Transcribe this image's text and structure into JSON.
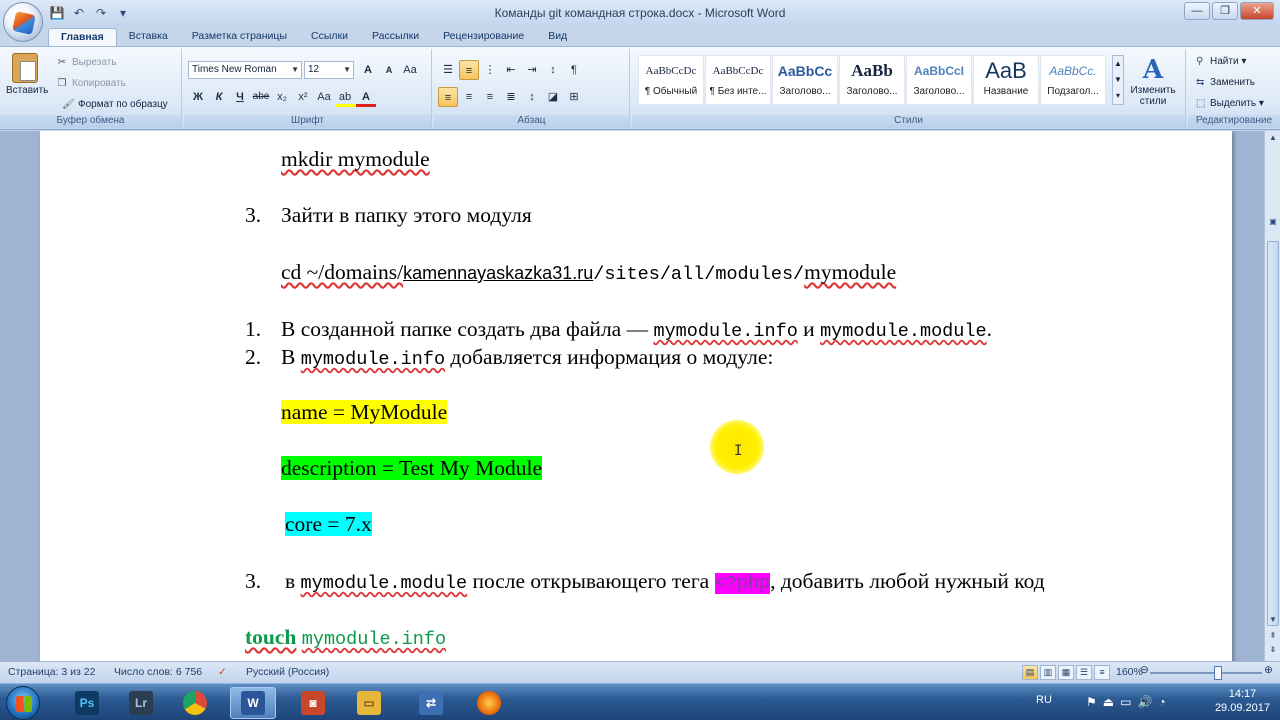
{
  "window": {
    "title": "Команды git командная строка.docx - Microsoft Word",
    "controls": [
      "—",
      "❐",
      "✕"
    ]
  },
  "qat": {
    "save": "💾",
    "undo": "↶",
    "redo": "↷",
    "more": "▾"
  },
  "tabs": [
    "Главная",
    "Вставка",
    "Разметка страницы",
    "Ссылки",
    "Рассылки",
    "Рецензирование",
    "Вид"
  ],
  "ribbon": {
    "clipboard": {
      "label": "Буфер обмена",
      "paste": "Вставить",
      "cut": "Вырезать",
      "copy": "Копировать",
      "format_painter": "Формат по образцу"
    },
    "font": {
      "label": "Шрифт",
      "font_name": "Times New Roman",
      "font_size": "12",
      "grow": "A",
      "shrink": "A",
      "clear": "Aa",
      "bold": "Ж",
      "italic": "К",
      "underline": "Ч",
      "strike": "abe",
      "sub": "x₂",
      "sup": "x²",
      "case": "Aa",
      "highlight": "ab",
      "fontcolor": "A"
    },
    "paragraph": {
      "label": "Абзац",
      "pilcrow": "¶"
    },
    "styles": {
      "label": "Стили",
      "items": [
        {
          "preview": "AaBbCcDc",
          "name": "¶ Обычный"
        },
        {
          "preview": "AaBbCcDc",
          "name": "¶ Без инте..."
        },
        {
          "preview": "AaBbCc",
          "name": "Заголово..."
        },
        {
          "preview": "AaBb",
          "name": "Заголово..."
        },
        {
          "preview": "AaBbCcI",
          "name": "Заголово..."
        },
        {
          "preview": "AaB",
          "name": "Название"
        },
        {
          "preview": "AaBbCc.",
          "name": "Подзагол..."
        }
      ],
      "change_styles": "Изменить стили"
    },
    "editing": {
      "label": "Редактирование",
      "find": "Найти",
      "replace": "Заменить",
      "select": "Выделить"
    }
  },
  "document": {
    "line1": "mkdir mymodule",
    "item3_num": "3.",
    "item3_text": "Зайти в папку этого модуля",
    "cd_prefix": "cd ~/domains/",
    "cd_link": "kamennayaskazka31.ru",
    "cd_path": "/sites/all/modules/",
    "cd_module": "mymodule",
    "item1_num": "1.",
    "item1_text": "В созданной папке создать два файла —",
    "file_info": "mymodule.info",
    "and": "и",
    "file_module": "mymodule.module",
    "dot": ".",
    "item2_num": "2.",
    "item2_pre": "В",
    "item2_post": "добавляется информация о модуле:",
    "name_line": "name = MyModule",
    "desc_line": "description = Test My Module",
    "core_line": "core = 7.x",
    "item3b_num": "3.",
    "item3b_pre": "в",
    "item3b_mid": "после открывающего тега",
    "php_tag": "<?php",
    "item3b_post": ", добавить любой нужный код",
    "touch": "touch",
    "touch_file": "mymodule.info"
  },
  "status": {
    "page": "Страница: 3 из 22",
    "words": "Число слов: 6 756",
    "language": "Русский (Россия)",
    "zoom": "160%"
  },
  "taskbar": {
    "apps": [
      {
        "name": "Ps",
        "color": "#0d3b63"
      },
      {
        "name": "Lr",
        "color": "#2b3d50"
      },
      {
        "name": "◎",
        "color": "#dd4b39"
      },
      {
        "name": "W",
        "color": "#2a5699"
      },
      {
        "name": "◙",
        "color": "#c7472a"
      },
      {
        "name": "▭",
        "color": "#e6b63d"
      },
      {
        "name": "⇄",
        "color": "#3f6fb3"
      },
      {
        "name": "◉",
        "color": "#e66000"
      }
    ],
    "lang": "RU",
    "time": "14:17",
    "date": "29.09.2017"
  },
  "colors": {
    "accent": "#2b579a",
    "highlight_yellow": "#ffff00",
    "highlight_green": "#00ff00",
    "highlight_cyan": "#00ffff",
    "highlight_magenta": "#ff00ff"
  }
}
